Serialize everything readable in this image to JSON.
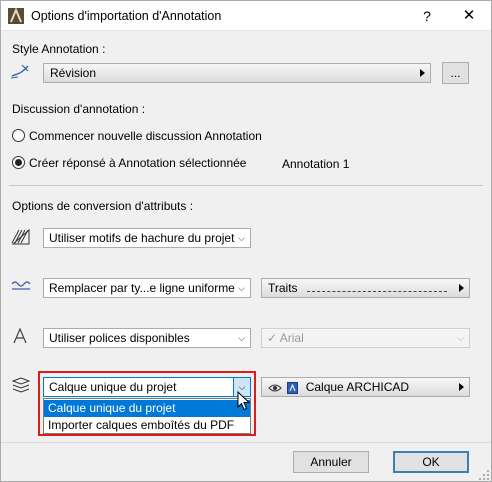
{
  "titlebar": {
    "title": "Options d'importation d'Annotation",
    "help_label": "?",
    "close_label": "✕"
  },
  "style": {
    "label": "Style Annotation :",
    "value": "Révision",
    "browse_label": "..."
  },
  "discussion": {
    "label": "Discussion d'annotation :",
    "option_new": "Commencer nouvelle discussion Annotation",
    "option_reply": "Créer réponsé à Annotation sélectionnée",
    "selected": "option_reply",
    "annotation_name": "Annotation 1"
  },
  "conversion": {
    "label": "Options de conversion d'attributs :",
    "hatch_value": "Utiliser motifs de hachure du projet",
    "line_value": "Remplacer par ty...e ligne uniforme",
    "line_type_value": "Traits",
    "font_value": "Utiliser polices disponibles",
    "font_name_value": "Arial",
    "layer_value": "Calque unique du projet",
    "layer_target_value": "Calque ARCHICAD"
  },
  "layer_dropdown": {
    "options": [
      "Calque unique du projet",
      "Importer calques emboîtés du PDF"
    ],
    "selected_index": 0
  },
  "footer": {
    "cancel_label": "Annuler",
    "ok_label": "OK"
  },
  "colors": {
    "highlight": "#d62020",
    "selection": "#0078d7",
    "default_button_border": "#3c7fb1"
  }
}
